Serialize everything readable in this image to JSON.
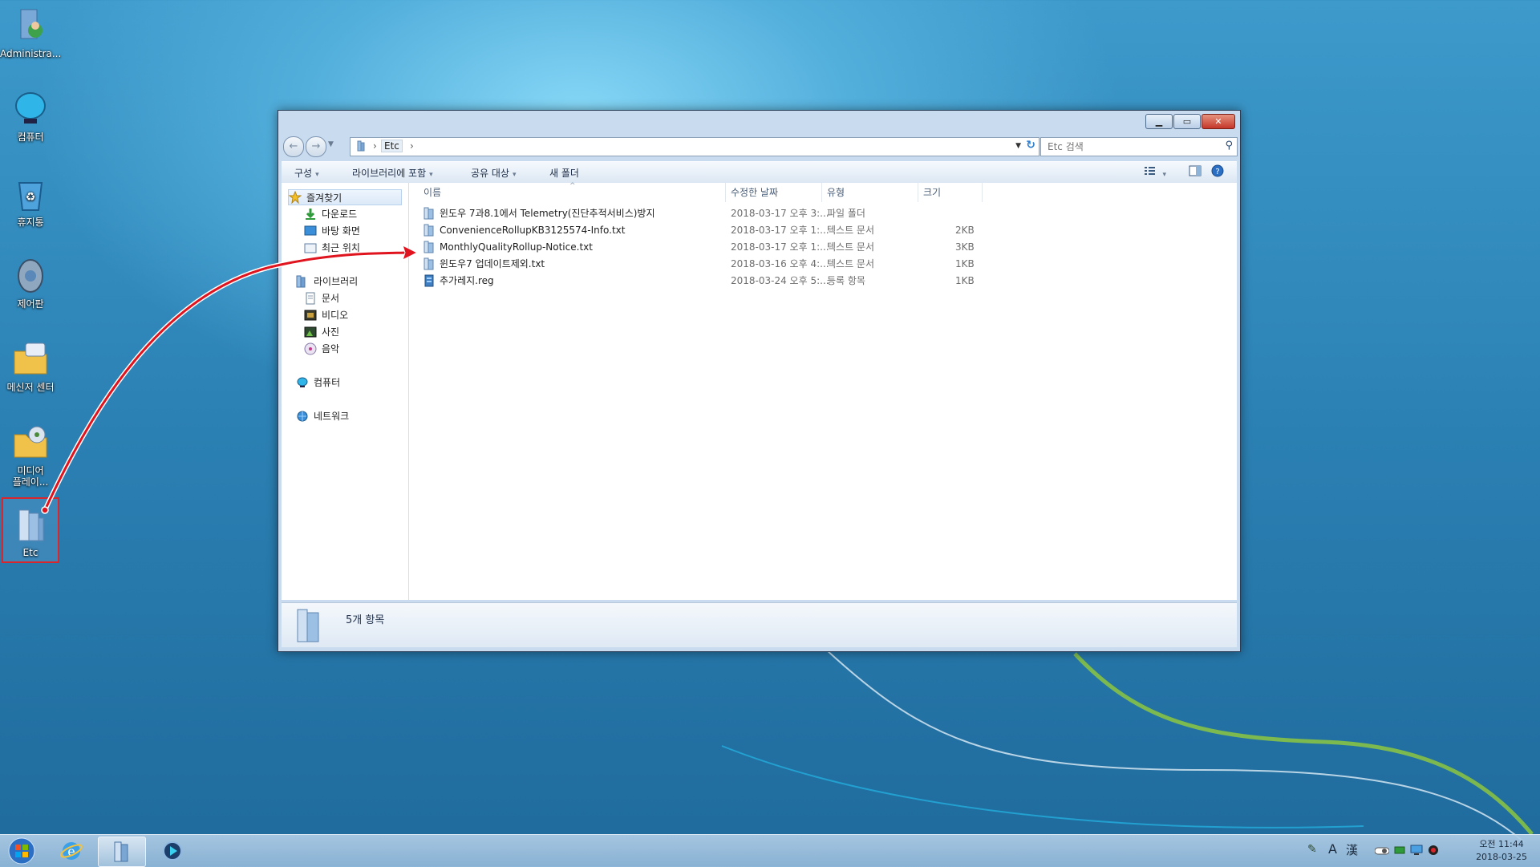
{
  "desktop": {
    "icons": [
      {
        "label": "Administra...",
        "name": "administrator"
      },
      {
        "label": "컴퓨터",
        "name": "computer"
      },
      {
        "label": "휴지통",
        "name": "recycle-bin"
      },
      {
        "label": "제어판",
        "name": "control-panel"
      },
      {
        "label": "메신저 센터",
        "name": "messenger-center"
      },
      {
        "label": "미디어\n플레이...",
        "name": "media-player"
      },
      {
        "label": "Etc",
        "name": "etc-folder"
      }
    ]
  },
  "explorer": {
    "address": {
      "folder": "Etc"
    },
    "search": {
      "placeholder": "Etc 검색"
    },
    "toolbar": {
      "organize": "구성",
      "include_library": "라이브러리에 포함",
      "share": "공유 대상",
      "new_folder": "새 폴더"
    },
    "nav": {
      "favorites": "즐겨찾기",
      "downloads": "다운로드",
      "desktop": "바탕 화면",
      "recent": "최근 위치",
      "libraries": "라이브러리",
      "documents": "문서",
      "videos": "비디오",
      "pictures": "사진",
      "music": "음악",
      "computer": "컴퓨터",
      "network": "네트워크"
    },
    "columns": {
      "name": "이름",
      "modified": "수정한 날짜",
      "type": "유형",
      "size": "크기"
    },
    "files": [
      {
        "name": "윈도우 7과8.1에서 Telemetry(진단추적서비스)방지",
        "modified": "2018-03-17 오후 3:...",
        "type": "파일 폴더",
        "size": "",
        "kind": "folder"
      },
      {
        "name": "ConvenienceRollupKB3125574-Info.txt",
        "modified": "2018-03-17 오후 1:...",
        "type": "텍스트 문서",
        "size": "2KB",
        "kind": "txt"
      },
      {
        "name": "MonthlyQualityRollup-Notice.txt",
        "modified": "2018-03-17 오후 1:...",
        "type": "텍스트 문서",
        "size": "3KB",
        "kind": "txt"
      },
      {
        "name": "윈도우7 업데이트제외.txt",
        "modified": "2018-03-16 오후 4:...",
        "type": "텍스트 문서",
        "size": "1KB",
        "kind": "txt"
      },
      {
        "name": "추가레지.reg",
        "modified": "2018-03-24 오후 5:...",
        "type": "등록 항목",
        "size": "1KB",
        "kind": "reg"
      }
    ],
    "status": {
      "item_count": "5개 항목"
    }
  },
  "taskbar": {
    "tray": {
      "ime_a": "A",
      "ime_han": "漢"
    },
    "clock": {
      "time": "오전 11:44",
      "date": "2018-03-25"
    }
  },
  "colors": {
    "selection_outline": "#d8262c",
    "arrow": "#e0141e",
    "taskbar": "#9ebfdd"
  }
}
